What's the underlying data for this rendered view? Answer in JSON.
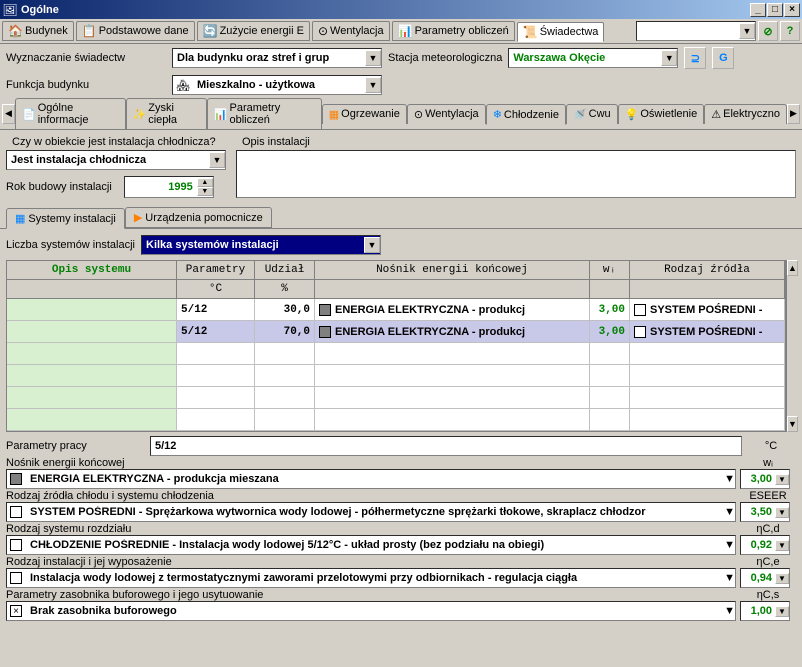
{
  "window": {
    "title": "Ogólne"
  },
  "maintabs": [
    {
      "label": "Budynek",
      "icon": "🏠"
    },
    {
      "label": "Podstawowe dane",
      "icon": "📋"
    },
    {
      "label": "Zużycie energii E",
      "icon": "🔄"
    },
    {
      "label": "Wentylacja",
      "icon": "⊙"
    },
    {
      "label": "Parametry obliczeń",
      "icon": "📊"
    },
    {
      "label": "Świadectwa",
      "icon": "📜",
      "active": true
    }
  ],
  "form": {
    "wyznaczanie_label": "Wyznaczanie świadectw",
    "wyznaczanie_value": "Dla budynku oraz stref i grup",
    "stacja_label": "Stacja meteorologiczna",
    "stacja_value": "Warszawa Okęcie",
    "funkcja_label": "Funkcja budynku",
    "funkcja_value": "Mieszkalno - użytkowa"
  },
  "subtabs": [
    {
      "label": "Ogólne informacje",
      "icon": "📄"
    },
    {
      "label": "Zyski ciepła",
      "icon": "✨"
    },
    {
      "label": "Parametry obliczeń",
      "icon": "📊"
    },
    {
      "label": "Ogrzewanie",
      "icon": "▦",
      "color": "#ff8000"
    },
    {
      "label": "Wentylacja",
      "icon": "⊙"
    },
    {
      "label": "Chłodzenie",
      "icon": "❄",
      "active": true,
      "color": "#0080ff"
    },
    {
      "label": "Cwu",
      "icon": "🚿"
    },
    {
      "label": "Oświetlenie",
      "icon": "💡"
    },
    {
      "label": "Elektryczno",
      "icon": "⚠"
    }
  ],
  "fields": {
    "czy_label": "Czy w obiekcie jest instalacja chłodnicza?",
    "czy_value": "Jest instalacja chłodnicza",
    "opis_label": "Opis instalacji",
    "opis_value": "",
    "rok_label": "Rok budowy instalacji",
    "rok_value": "1995"
  },
  "innertabs": [
    {
      "label": "Systemy instalacji",
      "icon": "▦",
      "active": true
    },
    {
      "label": "Urządzenia pomocnicze",
      "icon": "▶"
    }
  ],
  "liczba": {
    "label": "Liczba systemów instalacji",
    "value": "Kilka systemów instalacji"
  },
  "table": {
    "headers": [
      "Opis systemu",
      "Parametry",
      "Udział",
      "Nośnik energii końcowej",
      "wᵢ",
      "Rodzaj źródła"
    ],
    "subheaders": [
      "",
      "°C",
      "%",
      "",
      "",
      ""
    ],
    "rows": [
      {
        "opis": "",
        "param": "5/12",
        "udzial": "30,0",
        "nosnik": "ENERGIA ELEKTRYCZNA - produkcj",
        "wi": "3,00",
        "rodzaj": "SYSTEM POŚREDNI -"
      },
      {
        "opis": "",
        "param": "5/12",
        "udzial": "70,0",
        "nosnik": "ENERGIA ELEKTRYCZNA - produkcj",
        "wi": "3,00",
        "rodzaj": "SYSTEM POŚREDNI -",
        "sel": true
      }
    ]
  },
  "params": {
    "pracy_label": "Parametry pracy",
    "pracy_value": "5/12",
    "pracy_unit": "°C",
    "nosnik_label": "Nośnik energii końcowej",
    "nosnik_value": "ENERGIA ELEKTRYCZNA - produkcja mieszana",
    "wi_label": "wᵢ",
    "wi_value": "3,00",
    "rodzaj_src_label": "Rodzaj źródła chłodu i systemu chłodzenia",
    "rodzaj_src_value": "SYSTEM POŚREDNI - Sprężarkowa wytwornica wody lodowej - półhermetyczne sprężarki tłokowe, skraplacz chłodzor",
    "eseer_label": "ESEER",
    "eseer_value": "3,50",
    "system_label": "Rodzaj systemu rozdziału",
    "system_value": "CHŁODZENIE POŚREDNIE - Instalacja wody lodowej 5/12°C - układ prosty (bez podziału na obiegi)",
    "ncd_label": "ηC,d",
    "ncd_value": "0,92",
    "inst_label": "Rodzaj instalacji i jej wyposażenie",
    "inst_value": "Instalacja wody lodowej z termostatycznymi zaworami przelotowymi przy odbiornikach - regulacja ciągła",
    "nce_label": "ηC,e",
    "nce_value": "0,94",
    "zasob_label": "Parametry zasobnika buforowego i jego usytuowanie",
    "zasob_value": "Brak zasobnika buforowego",
    "ncs_label": "ηC,s",
    "ncs_value": "1,00"
  }
}
